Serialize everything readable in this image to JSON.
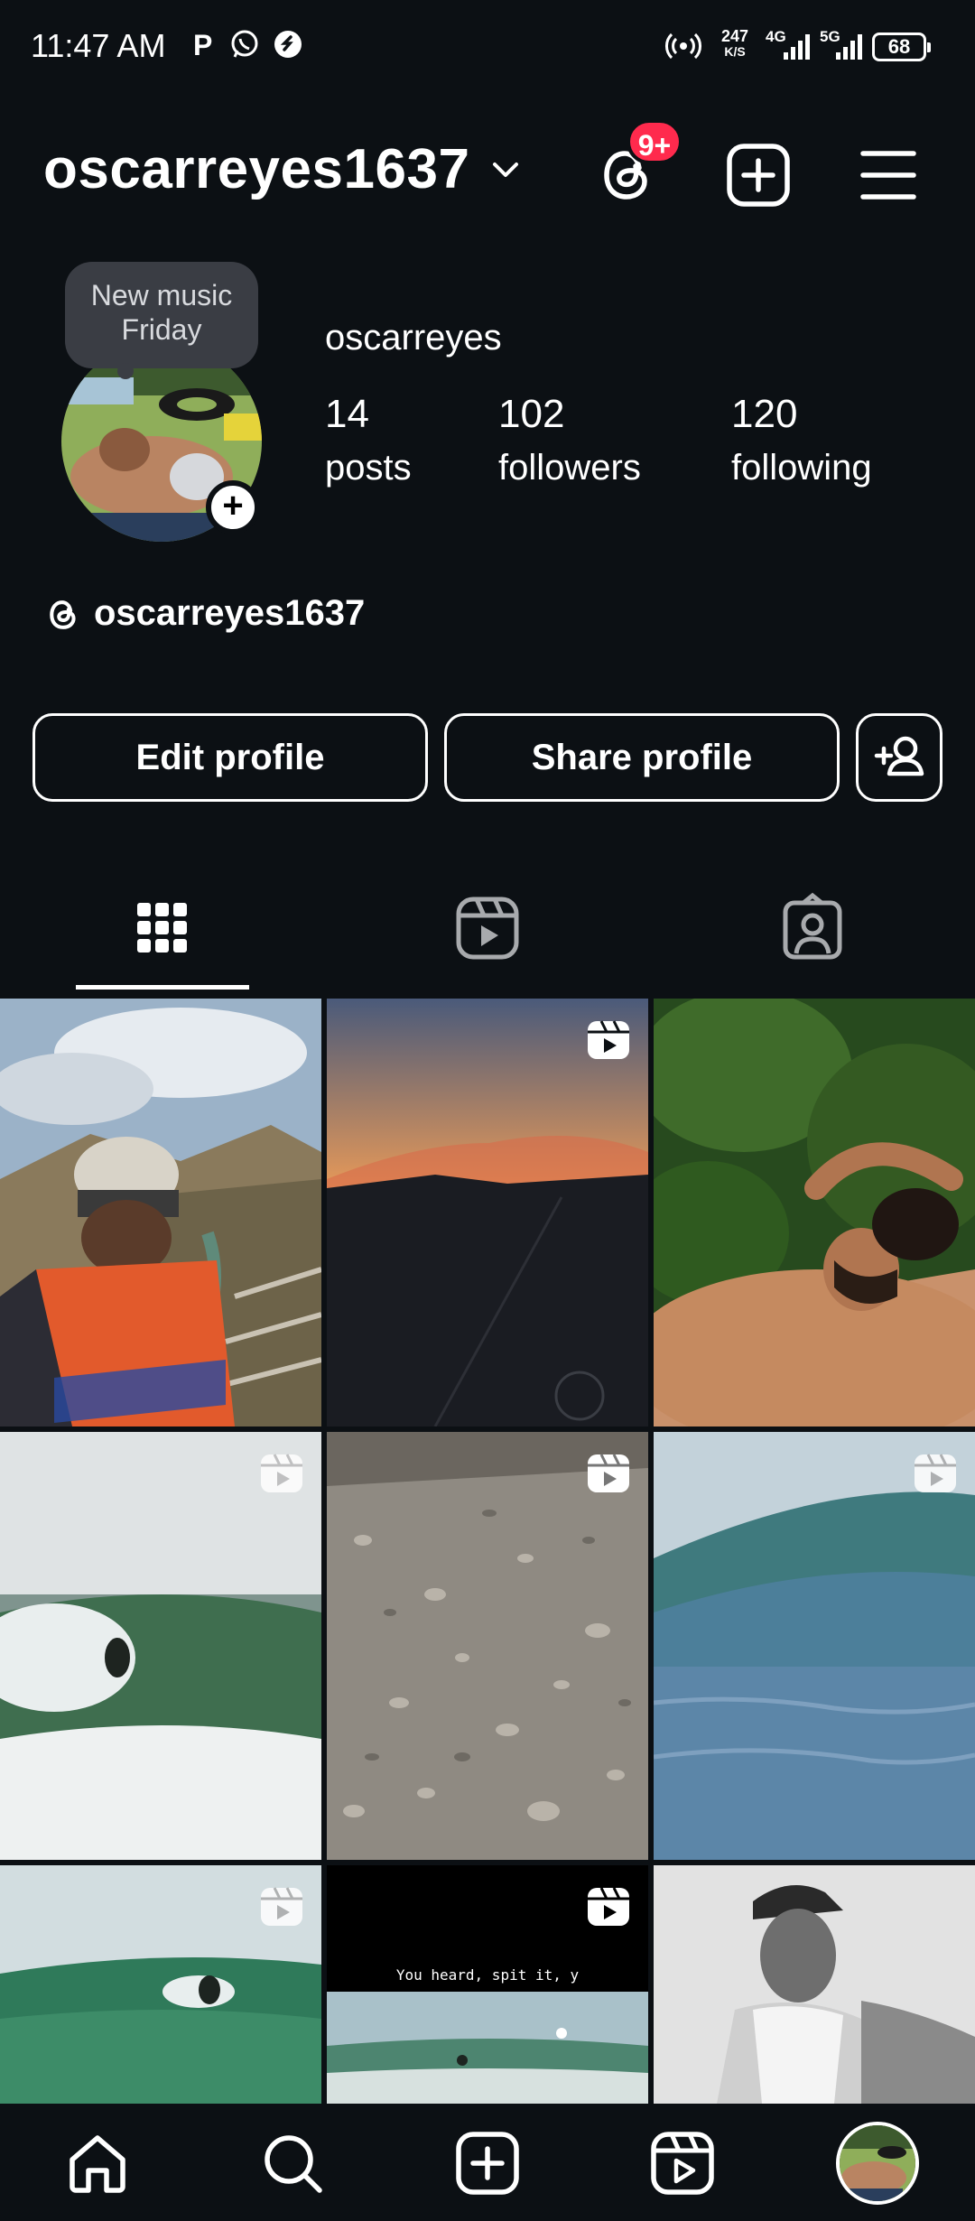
{
  "status_bar": {
    "time": "11:47 AM",
    "net_speed_value": "247",
    "net_speed_unit": "K/S",
    "net_4g": "4G",
    "net_5g": "5G",
    "battery": "68"
  },
  "header": {
    "username": "oscarreyes1637",
    "threads_badge": "9+"
  },
  "profile": {
    "note": "New music Friday",
    "display_name": "oscarreyes",
    "stats": [
      {
        "value": "14",
        "label": "posts"
      },
      {
        "value": "102",
        "label": "followers"
      },
      {
        "value": "120",
        "label": "following"
      }
    ],
    "threads_handle": "oscarreyes1637"
  },
  "actions": {
    "edit_profile": "Edit profile",
    "share_profile": "Share profile"
  },
  "tabs": [
    "grid",
    "reels",
    "tagged"
  ],
  "grid": {
    "tiles": [
      {
        "scene": "hiker-canyon",
        "reel": false
      },
      {
        "scene": "sunset-road",
        "reel": true
      },
      {
        "scene": "sunbathing-man",
        "reel": false
      },
      {
        "scene": "surfer-wave",
        "reel": true
      },
      {
        "scene": "gravel-ground",
        "reel": true
      },
      {
        "scene": "ocean-wave",
        "reel": true
      },
      {
        "scene": "surfer-barrel",
        "reel": true
      },
      {
        "scene": "beach-surfers",
        "reel": true,
        "caption": "You heard, spit it, y"
      },
      {
        "scene": "portrait-bw",
        "reel": false
      }
    ]
  },
  "bottom_nav": [
    "home",
    "search",
    "create",
    "reels",
    "profile"
  ],
  "colors": {
    "background": "#0c1014",
    "badge": "#ff2a4d",
    "text": "#ffffff"
  }
}
